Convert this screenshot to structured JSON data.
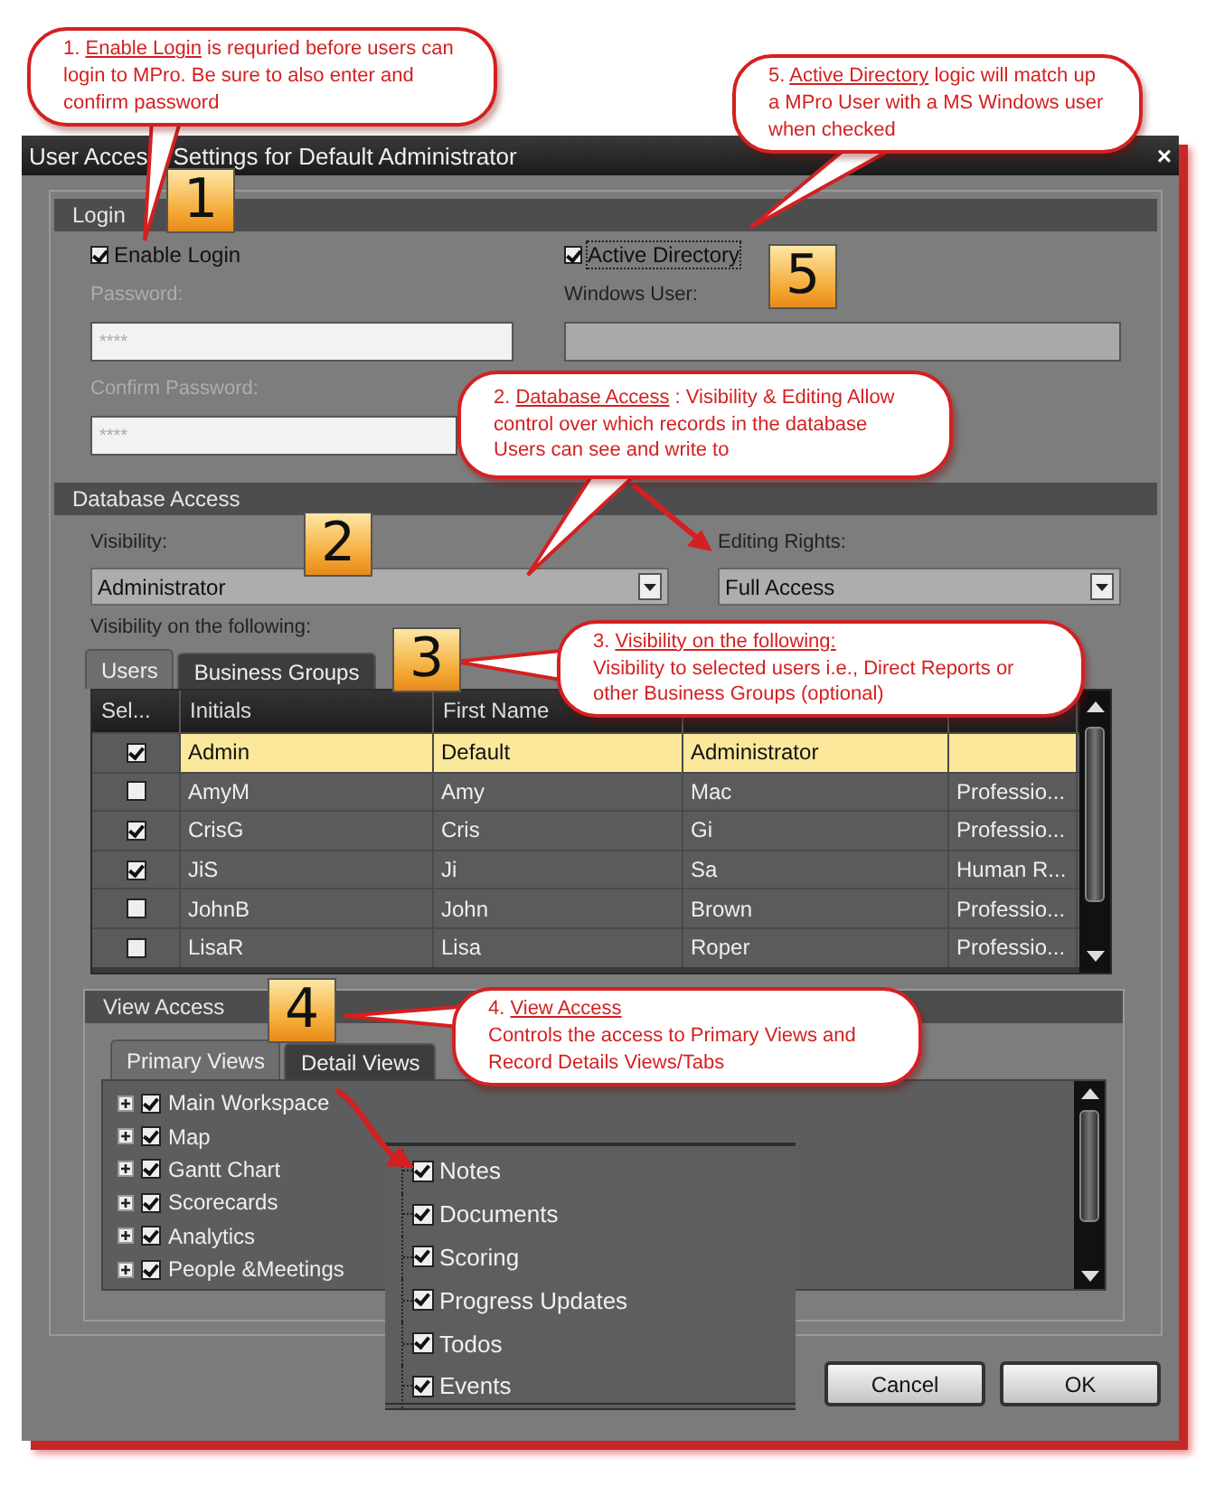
{
  "window": {
    "title": [
      "User Acces",
      "Settings for Default Administrator"
    ],
    "close": "×"
  },
  "login": {
    "header": "Login",
    "enable_login": {
      "label": "Enable Login",
      "checked": true
    },
    "active_directory": {
      "label": "Active Directory",
      "checked": true
    },
    "password": {
      "label": "Password:",
      "value": "****",
      "disabled": true
    },
    "windows_user": {
      "label": "Windows User:",
      "disabled": true
    },
    "confirm_password": {
      "label": "Confirm Password:",
      "value": "****",
      "disabled": true
    }
  },
  "database_access": {
    "header": "Database Access",
    "visibility": {
      "label": "Visibility:",
      "value": "Administrator"
    },
    "editing_rights": {
      "label": "Editing Rights:",
      "value": "Full Access"
    },
    "visibility_on_label": "Visibility on the following:",
    "tabs": [
      {
        "label": "Users",
        "selected": true
      },
      {
        "label": "Business Groups",
        "selected": false
      }
    ],
    "table": {
      "select_column": "Sel...",
      "columns": [
        "Initials",
        "First Name"
      ],
      "rows": [
        {
          "checked": true,
          "selected": true,
          "cells": [
            "Admin",
            "Default",
            "Administrator"
          ]
        },
        {
          "checked": false,
          "selected": false,
          "cells": [
            "AmyM",
            "Amy",
            "Mac",
            "Professio..."
          ]
        },
        {
          "checked": true,
          "selected": false,
          "cells": [
            "CrisG",
            "Cris",
            "Gi",
            "Professio..."
          ]
        },
        {
          "checked": true,
          "selected": false,
          "cells": [
            "JiS",
            "Ji",
            "Sa",
            "Human R..."
          ]
        },
        {
          "checked": false,
          "selected": false,
          "cells": [
            "JohnB",
            "John",
            "Brown",
            "Professio..."
          ]
        },
        {
          "checked": false,
          "selected": false,
          "cells": [
            "LisaR",
            "Lisa",
            "Roper",
            "Professio..."
          ]
        }
      ]
    }
  },
  "view_access": {
    "header": "View Access",
    "tabs": [
      {
        "label": "Primary Views",
        "selected": true
      },
      {
        "label": "Detail Views",
        "selected": false
      }
    ],
    "primary_views": [
      {
        "label": "Main Workspace",
        "checked": true,
        "expanded": false
      },
      {
        "label": "Map",
        "checked": true,
        "expanded": false
      },
      {
        "label": "Gantt Chart",
        "checked": true,
        "expanded": false
      },
      {
        "label": "Scorecards",
        "checked": true,
        "expanded": false
      },
      {
        "label": "Analytics",
        "checked": true,
        "expanded": false
      },
      {
        "label": "People &Meetings",
        "checked": true,
        "expanded": false
      }
    ],
    "detail_views": [
      {
        "label": "Notes",
        "checked": true
      },
      {
        "label": "Documents",
        "checked": true
      },
      {
        "label": "Scoring",
        "checked": true
      },
      {
        "label": "Progress Updates",
        "checked": true
      },
      {
        "label": "Todos",
        "checked": true
      },
      {
        "label": "Events",
        "checked": true
      }
    ]
  },
  "buttons": [
    "Cancel",
    "OK"
  ],
  "badges": [
    "1",
    "5",
    "2",
    "3",
    "4"
  ],
  "callouts": [
    {
      "kind": "inline",
      "number": "1.",
      "heading": "Enable Login",
      "text": "is requried before users can login to MPro. Be sure to also  enter and confirm password"
    },
    {
      "kind": "inline",
      "number": "5.",
      "heading": "Active Directory",
      "text": "logic will match up a MPro User with a MS Windows user when checked"
    },
    {
      "kind": "inline",
      "number": "2.",
      "heading": "Database Access",
      "text": ": Visibility & Editing Allow control over which records in the database Users can see and write to"
    },
    {
      "kind": "block",
      "number": "3.",
      "heading": "Visibility on the following:",
      "text": "Visibility to selected users  i.e., Direct Reports or other Business Groups (optional)"
    },
    {
      "kind": "block",
      "number": "4.",
      "heading": "View Access",
      "text": "Controls the access to Primary Views and Record Details Views/Tabs"
    }
  ]
}
